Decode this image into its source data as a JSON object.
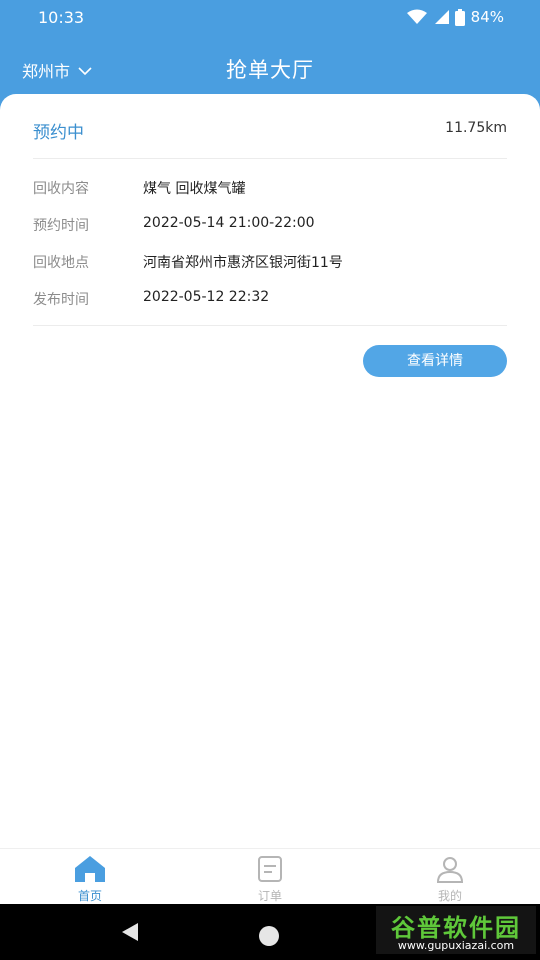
{
  "status_bar": {
    "time": "10:33",
    "battery": "84%"
  },
  "header": {
    "city": "郑州市",
    "title": "抢单大厅"
  },
  "order": {
    "status": "预约中",
    "distance": "11.75km",
    "rows": [
      {
        "label": "回收内容",
        "value": "煤气  回收煤气罐"
      },
      {
        "label": "预约时间",
        "value": "2022-05-14 21:00-22:00"
      },
      {
        "label": "回收地点",
        "value": "河南省郑州市惠济区银河街11号"
      },
      {
        "label": "发布时间",
        "value": "2022-05-12 22:32"
      }
    ],
    "detail_button": "查看详情"
  },
  "tabs": [
    {
      "label": "首页",
      "icon": "home-icon",
      "active": true
    },
    {
      "label": "订单",
      "icon": "order-icon",
      "active": false
    },
    {
      "label": "我的",
      "icon": "profile-icon",
      "active": false
    }
  ],
  "watermark": {
    "main": "谷普软件园",
    "sub": "www.gupuxiazai.com"
  },
  "colors": {
    "accent": "#4a9ee0",
    "active_tab": "#3b8fcf",
    "inactive_tab": "#b5b5b5"
  }
}
